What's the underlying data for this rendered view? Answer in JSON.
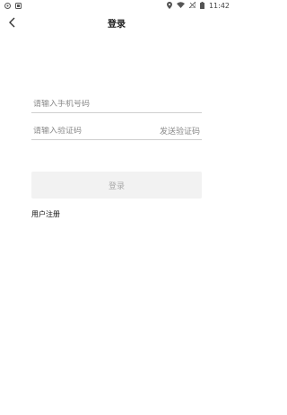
{
  "status_bar": {
    "time": "11:42",
    "icons": [
      "app-notification-icon",
      "sim-notification-icon",
      "location-icon",
      "wifi-icon",
      "signal-icon",
      "battery-icon"
    ]
  },
  "header": {
    "title": "登录",
    "back_icon": "chevron-left-icon"
  },
  "form": {
    "phone_placeholder": "请输入手机号码",
    "phone_value": "",
    "code_placeholder": "请输入验证码",
    "code_value": "",
    "send_code_label": "发送验证码",
    "login_label": "登录",
    "register_label": "用户注册"
  },
  "colors": {
    "background": "#ffffff",
    "divider": "#cfcfcf",
    "placeholder": "#8a8a8a",
    "button_bg": "#f2f2f2",
    "button_text": "#aaaaaa"
  }
}
